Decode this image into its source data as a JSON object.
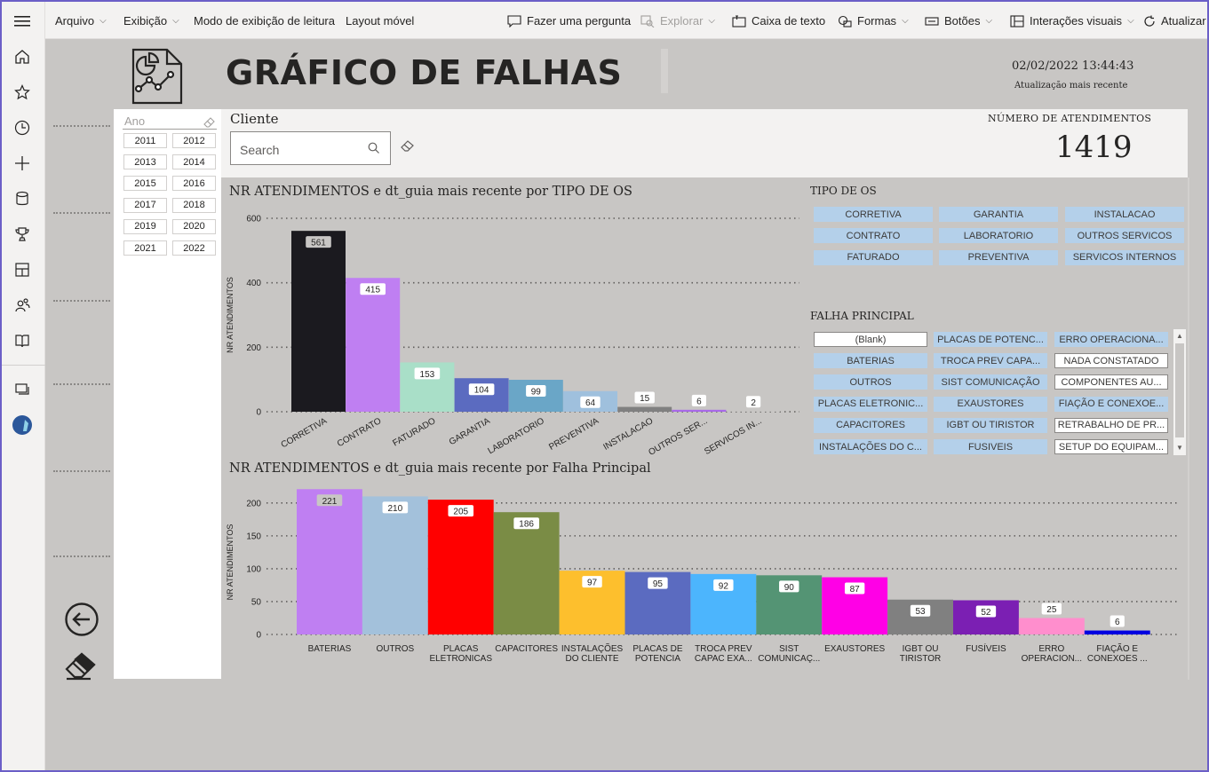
{
  "rail": {
    "items": [
      "menu-icon",
      "home-icon",
      "star-icon",
      "clock-icon",
      "plus-icon",
      "database-icon",
      "trophy-icon",
      "apps-icon",
      "people-icon",
      "book-icon",
      "workspace-icon",
      "avatar-icon"
    ]
  },
  "toolbar": {
    "arquivo": "Arquivo",
    "exibicao": "Exibição",
    "modo_leitura": "Modo de exibição de leitura",
    "layout_movel": "Layout móvel",
    "pergunta": "Fazer uma pergunta",
    "explorar": "Explorar",
    "caixa_texto": "Caixa de texto",
    "formas": "Formas",
    "botoes": "Botões",
    "interacoes": "Interações visuais",
    "atualizar": "Atualizar"
  },
  "header": {
    "title": "GRÁFICO DE FALHAS",
    "datetime": "02/02/2022 13:44:43",
    "datetime_label": "Atualização mais recente"
  },
  "ano_slicer": {
    "label": "Ano",
    "years": [
      "2011",
      "2012",
      "2013",
      "2014",
      "2015",
      "2016",
      "2017",
      "2018",
      "2019",
      "2020",
      "2021",
      "2022"
    ]
  },
  "cliente": {
    "label": "Cliente",
    "placeholder": "Search"
  },
  "kpi": {
    "label": "NÚMERO DE ATENDIMENTOS",
    "value": "1419"
  },
  "tipo_os_slicer": {
    "label": "TIPO DE OS",
    "items": [
      "CORRETIVA",
      "GARANTIA",
      "INSTALACAO",
      "CONTRATO",
      "LABORATORIO",
      "OUTROS SERVICOS",
      "FATURADO",
      "PREVENTIVA",
      "SERVICOS INTERNOS"
    ]
  },
  "falha_slicer": {
    "label": "FALHA PRINCIPAL",
    "items": [
      {
        "label": "(Blank)",
        "selected": true
      },
      {
        "label": "PLACAS DE POTENC...",
        "selected": false
      },
      {
        "label": "ERRO OPERACIONA...",
        "selected": false
      },
      {
        "label": "BATERIAS",
        "selected": false
      },
      {
        "label": "TROCA PREV CAPA...",
        "selected": false
      },
      {
        "label": "NADA CONSTATADO",
        "selected": true
      },
      {
        "label": "OUTROS",
        "selected": false
      },
      {
        "label": "SIST COMUNICAÇÃO",
        "selected": false
      },
      {
        "label": "COMPONENTES AU...",
        "selected": true
      },
      {
        "label": "PLACAS ELETRONIC...",
        "selected": false
      },
      {
        "label": "EXAUSTORES",
        "selected": false
      },
      {
        "label": "FIAÇÃO E CONEXOE...",
        "selected": false
      },
      {
        "label": "CAPACITORES",
        "selected": false
      },
      {
        "label": "IGBT OU TIRISTOR",
        "selected": false
      },
      {
        "label": "RETRABALHO DE PR...",
        "selected": true
      },
      {
        "label": "INSTALAÇÕES DO C...",
        "selected": false
      },
      {
        "label": "FUSIVEIS",
        "selected": false
      },
      {
        "label": "SETUP DO EQUIPAM...",
        "selected": true
      }
    ]
  },
  "chart_data": [
    {
      "type": "bar",
      "title": "NR ATENDIMENTOS e dt_guia mais recente por TIPO DE OS",
      "xlabel": "",
      "ylabel": "NR ATENDIMENTOS",
      "ylim": [
        0,
        600
      ],
      "yticks": [
        "0",
        "200",
        "400",
        "600"
      ],
      "categories": [
        "CORRETIVA",
        "CONTRATO",
        "FATURADO",
        "GARANTIA",
        "LABORATORIO",
        "PREVENTIVA",
        "INSTALACAO",
        "OUTROS SER...",
        "SERVICOS IN..."
      ],
      "values": [
        561,
        415,
        153,
        104,
        99,
        64,
        15,
        6,
        2
      ],
      "colors": [
        "#1b1a1f",
        "#bf7ff2",
        "#a9dfc8",
        "#5b6bc0",
        "#6aa6c7",
        "#9fc0dd",
        "#808080",
        "#a869e8",
        "#c8c6c4"
      ],
      "grid": true
    },
    {
      "type": "bar",
      "title": "NR ATENDIMENTOS e dt_guia mais recente por Falha Principal",
      "xlabel": "",
      "ylabel": "NR ATENDIMENTOS",
      "ylim": [
        0,
        220
      ],
      "yticks": [
        "0",
        "50",
        "100",
        "150",
        "200"
      ],
      "categories": [
        [
          "BATERIAS"
        ],
        [
          "OUTROS"
        ],
        [
          "PLACAS",
          "ELETRONICAS"
        ],
        [
          "CAPACITORES"
        ],
        [
          "INSTALAÇÕES",
          "DO CLIENTE"
        ],
        [
          "PLACAS DE",
          "POTENCIA"
        ],
        [
          "TROCA PREV",
          "CAPAC EXA..."
        ],
        [
          "SIST",
          "COMUNICAÇ..."
        ],
        [
          "EXAUSTORES"
        ],
        [
          "IGBT OU",
          "TIRISTOR"
        ],
        [
          "FUSÍVEIS"
        ],
        [
          "ERRO",
          "OPERACION..."
        ],
        [
          "FIAÇÃO E",
          "CONEXOES ..."
        ]
      ],
      "values": [
        221,
        210,
        205,
        186,
        97,
        95,
        92,
        90,
        87,
        53,
        52,
        25,
        6
      ],
      "colors": [
        "#bf7ff2",
        "#a3c1db",
        "#ff0000",
        "#7a8c45",
        "#fdbf2d",
        "#5b6bc0",
        "#4cb5fd",
        "#549474",
        "#ff00e6",
        "#808080",
        "#7b1fb3",
        "#ff8ecd",
        "#0000e0"
      ],
      "grid": true
    }
  ]
}
